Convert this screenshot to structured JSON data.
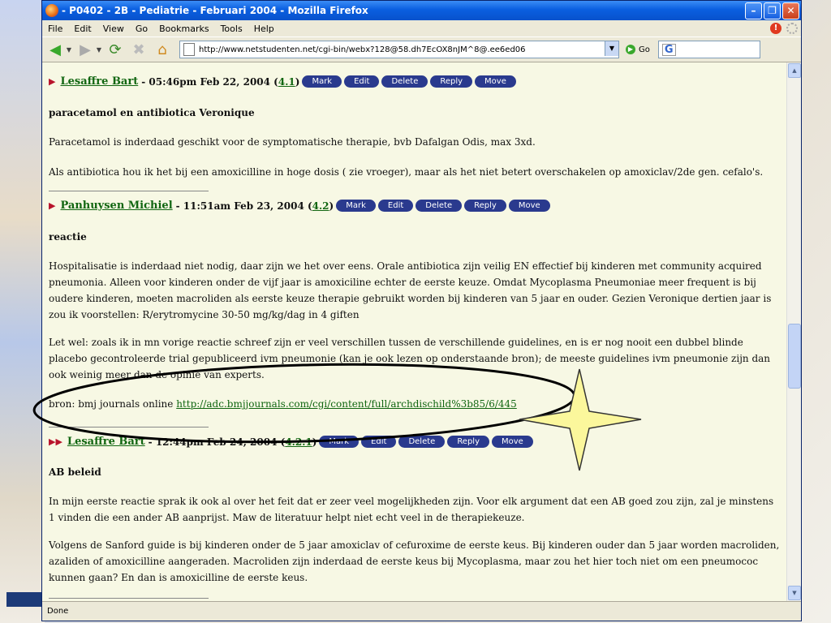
{
  "window": {
    "title": "- P0402 - 2B - Pediatrie - Februari 2004 - Mozilla Firefox"
  },
  "menu": [
    "File",
    "Edit",
    "View",
    "Go",
    "Bookmarks",
    "Tools",
    "Help"
  ],
  "address": {
    "url": "http://www.netstudenten.net/cgi-bin/webx?128@58.dh7EcOX8nJM^8@.ee6ed06",
    "go_label": "Go"
  },
  "status": "Done",
  "post_buttons": {
    "mark": "Mark",
    "edit": "Edit",
    "delete": "Delete",
    "reply": "Reply",
    "move": "Move"
  },
  "posts": [
    {
      "author": "Lesaffre Bart",
      "meta": "- 05:46pm Feb 22, 2004 (",
      "ref": "4.1",
      "subject": "paracetamol en antibiotica Veronique",
      "paragraphs": [
        "Paracetamol is inderdaad geschikt voor de symptomatische therapie, bvb Dafalgan Odis, max 3xd.",
        "Als antibiotica hou ik het bij een amoxicilline in hoge dosis ( zie vroeger), maar als het niet betert overschakelen op amoxiclav/2de gen. cefalo's."
      ]
    },
    {
      "author": "Panhuysen Michiel",
      "meta": "- 11:51am Feb 23, 2004 (",
      "ref": "4.2",
      "subject": "reactie",
      "paragraphs": [
        "Hospitalisatie is inderdaad niet nodig, daar zijn we het over eens. Orale antibiotica zijn veilig EN effectief bij kinderen met community acquired pneumonia. Alleen voor kinderen onder de vijf jaar is amoxiciline echter de eerste keuze. Omdat Mycoplasma Pneumoniae meer frequent is bij oudere kinderen, moeten macroliden als eerste keuze therapie gebruikt worden bij kinderen van 5 jaar en ouder. Gezien Veronique dertien jaar is zou ik voorstellen: R/erytromycine 30-50 mg/kg/dag in 4 giften",
        "Let wel: zoals ik in mn vorige reactie schreef zijn er veel verschillen tussen de verschillende guidelines, en is er nog nooit een dubbel blinde placebo gecontroleerde trial gepubliceerd ivm pneumonie (kan je ook lezen op onderstaande bron); de meeste guidelines ivm pneumonie zijn dan ook weinig meer dan de opinie van experts."
      ],
      "source_label": "bron: bmj journals online ",
      "source_link": "http://adc.bmjjournals.com/cgi/content/full/archdischild%3b85/6/445"
    },
    {
      "author": "Lesaffre Bart",
      "meta": "- 12:44pm Feb 24, 2004 (",
      "ref": "4.2.1",
      "subject": "AB beleid",
      "paragraphs": [
        "In mijn eerste reactie sprak ik ook al over het feit dat er zeer veel mogelijkheden zijn. Voor elk argument dat een AB goed zou zijn, zal je minstens 1 vinden die een ander AB aanprijst. Maw de literatuur helpt niet echt veel in de therapiekeuze.",
        "Volgens de Sanford guide is bij kinderen onder de 5 jaar amoxiclav of cefuroxime de eerste keus. Bij kinderen ouder dan 5 jaar worden macroliden, azaliden of amoxicilline aangeraden. Macroliden zijn inderdaad de eerste keus bij Mycoplasma, maar zou het hier toch niet om een pneumococ kunnen gaan? En dan is amoxicilline de eerste keus."
      ]
    }
  ]
}
